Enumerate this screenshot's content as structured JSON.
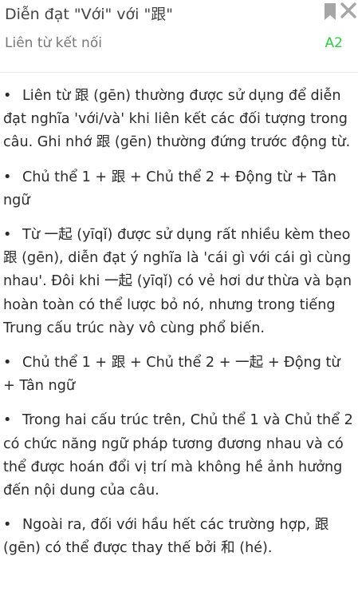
{
  "header": {
    "title": "Diễn đạt \"Với\" với \"跟\"",
    "subtitle": "Liên từ kết nối",
    "level": "A2",
    "level_color": "#2ecc40",
    "bookmark_icon": "bookmark-icon",
    "close_icon": "close-icon"
  },
  "bullet_char": "•",
  "paragraphs": [
    "Liên từ 跟 (gēn) thường được sử dụng để diễn đạt nghĩa 'với/và' khi liên kết các đối tượng trong câu. Ghi nhớ 跟 (gēn) thường đứng trước động từ.",
    "Chủ thể 1 + 跟 + Chủ thể 2 + Động từ + Tân ngữ",
    "Từ 一起 (yīqǐ) được sử dụng rất nhiều kèm theo 跟 (gēn), diễn đạt ý nghĩa là 'cái gì với cái gì cùng nhau'. Đôi khi 一起 (yīqǐ) có vẻ hơi dư thừa và bạn hoàn toàn có thể lược bỏ nó, nhưng trong tiếng Trung cấu trúc này vô cùng phổ biến.",
    "Chủ thể 1 + 跟 + Chủ thể 2 + 一起 + Động từ + Tân ngữ",
    "Trong hai cấu trúc trên, Chủ thể 1 và Chủ thể 2 có chức năng ngữ pháp tương đương nhau và có thể được hoán đổi vị trí mà không hề ảnh hưởng đến nội dung của câu.",
    "Ngoài ra, đối với hầu hết các trường hợp, 跟 (gēn) có thể được thay thế bởi 和 (hé)."
  ]
}
